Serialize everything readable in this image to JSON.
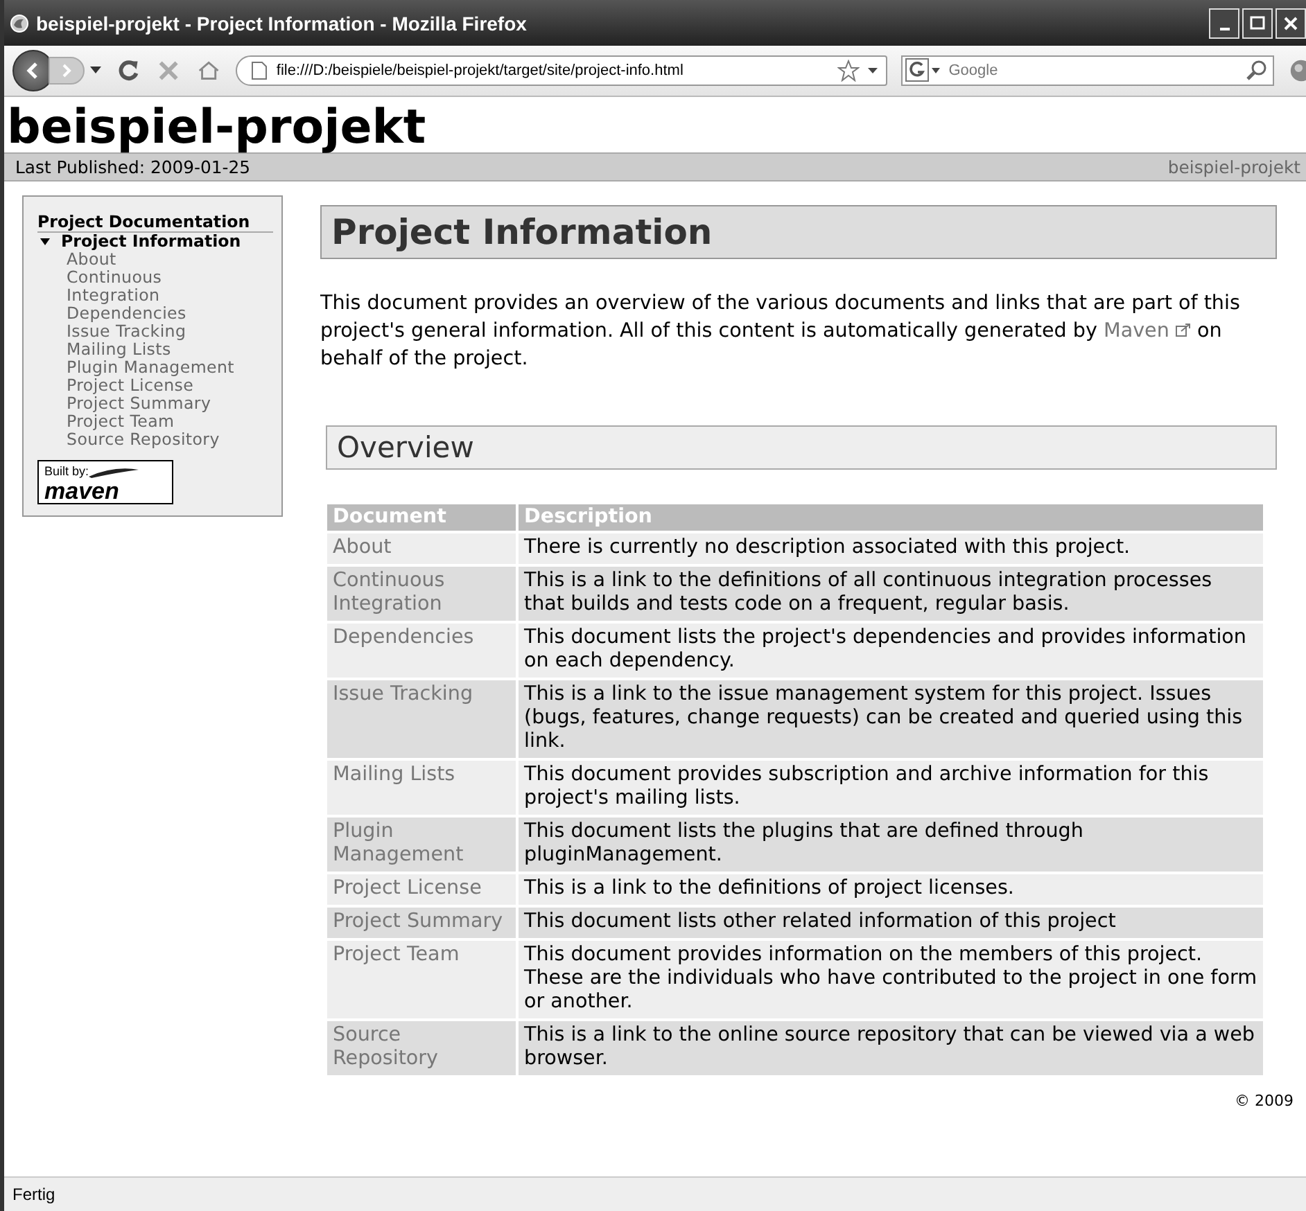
{
  "window": {
    "title": "beispiel-projekt - Project Information - Mozilla Firefox"
  },
  "toolbar": {
    "address": "file:///D:/beispiele/beispiel-projekt/target/site/project-info.html",
    "search": {
      "placeholder": "Google"
    }
  },
  "site": {
    "title": "beispiel-projekt",
    "last_published": "Last Published: 2009-01-25",
    "banner_right": "beispiel-projekt"
  },
  "sidebar": {
    "heading": "Project Documentation",
    "items": [
      {
        "label": "Project Information",
        "expanded": true,
        "children": [
          {
            "label": "About"
          },
          {
            "label": "Continuous Integration"
          },
          {
            "label": "Dependencies"
          },
          {
            "label": "Issue Tracking"
          },
          {
            "label": "Mailing Lists"
          },
          {
            "label": "Plugin Management"
          },
          {
            "label": "Project License"
          },
          {
            "label": "Project Summary"
          },
          {
            "label": "Project Team"
          },
          {
            "label": "Source Repository"
          }
        ]
      }
    ],
    "badge": {
      "top": "Built by:",
      "bottom": "maven"
    }
  },
  "main": {
    "heading": "Project Information",
    "intro": {
      "before": "This document provides an overview of the various documents and links that are part of this project's general information. All of this content is automatically generated by",
      "link": "Maven",
      "after": "on behalf of the project."
    },
    "section": "Overview",
    "table": {
      "columns": [
        "Document",
        "Description"
      ],
      "rows": [
        {
          "document": "About",
          "description": "There is currently no description associated with this project."
        },
        {
          "document": "Continuous Integration",
          "description": "This is a link to the definitions of all continuous integration processes that builds and tests code on a frequent, regular basis."
        },
        {
          "document": "Dependencies",
          "description": "This document lists the project's dependencies and provides information on each dependency."
        },
        {
          "document": "Issue Tracking",
          "description": "This is a link to the issue management system for this project. Issues (bugs, features, change requests) can be created and queried using this link."
        },
        {
          "document": "Mailing Lists",
          "description": "This document provides subscription and archive information for this project's mailing lists."
        },
        {
          "document": "Plugin Management",
          "description": "This document lists the plugins that are defined through pluginManagement."
        },
        {
          "document": "Project License",
          "description": "This is a link to the definitions of project licenses."
        },
        {
          "document": "Project Summary",
          "description": "This document lists other related information of this project"
        },
        {
          "document": "Project Team",
          "description": "This document provides information on the members of this project. These are the individuals who have contributed to the project in one form or another."
        },
        {
          "document": "Source Repository",
          "description": "This is a link to the online source repository that can be viewed via a web browser."
        }
      ]
    },
    "footer": "© 2009"
  },
  "status_bar": "Fertig"
}
